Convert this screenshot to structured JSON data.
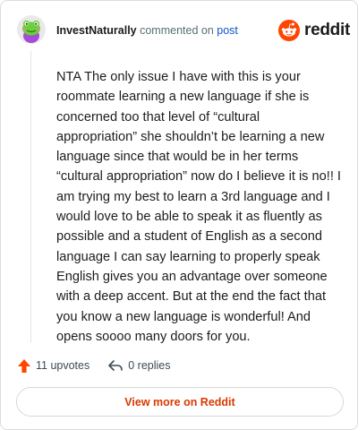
{
  "header": {
    "username": "InvestNaturally",
    "action_text": "commented on",
    "post_link": "post"
  },
  "brand": {
    "name": "reddit",
    "icon": "reddit-alien-icon",
    "color": "#ff4500"
  },
  "avatar": {
    "icon": "frog-avatar-icon"
  },
  "comment": {
    "text": "NTA The only issue I have with this is your roommate learning a new language if she is concerned too that level of “cultural appropriation” she shouldn’t be learning a new language since that would be in her terms “cultural appropriation” now do I believe it is no!! I am trying my best to learn a 3rd language and I would love to be able to speak it as fluently as possible and a student of English as a second language I can say learning to properly speak English gives you an advantage over someone with a deep accent. But at the end the fact that you know a new language is wonderful! And opens soooo many doors for you."
  },
  "actions": {
    "upvotes": "11 upvotes",
    "replies": "0 replies",
    "upvote_color": "#ff4500"
  },
  "footer": {
    "view_more": "View more on Reddit",
    "accent": "#d93a00"
  }
}
